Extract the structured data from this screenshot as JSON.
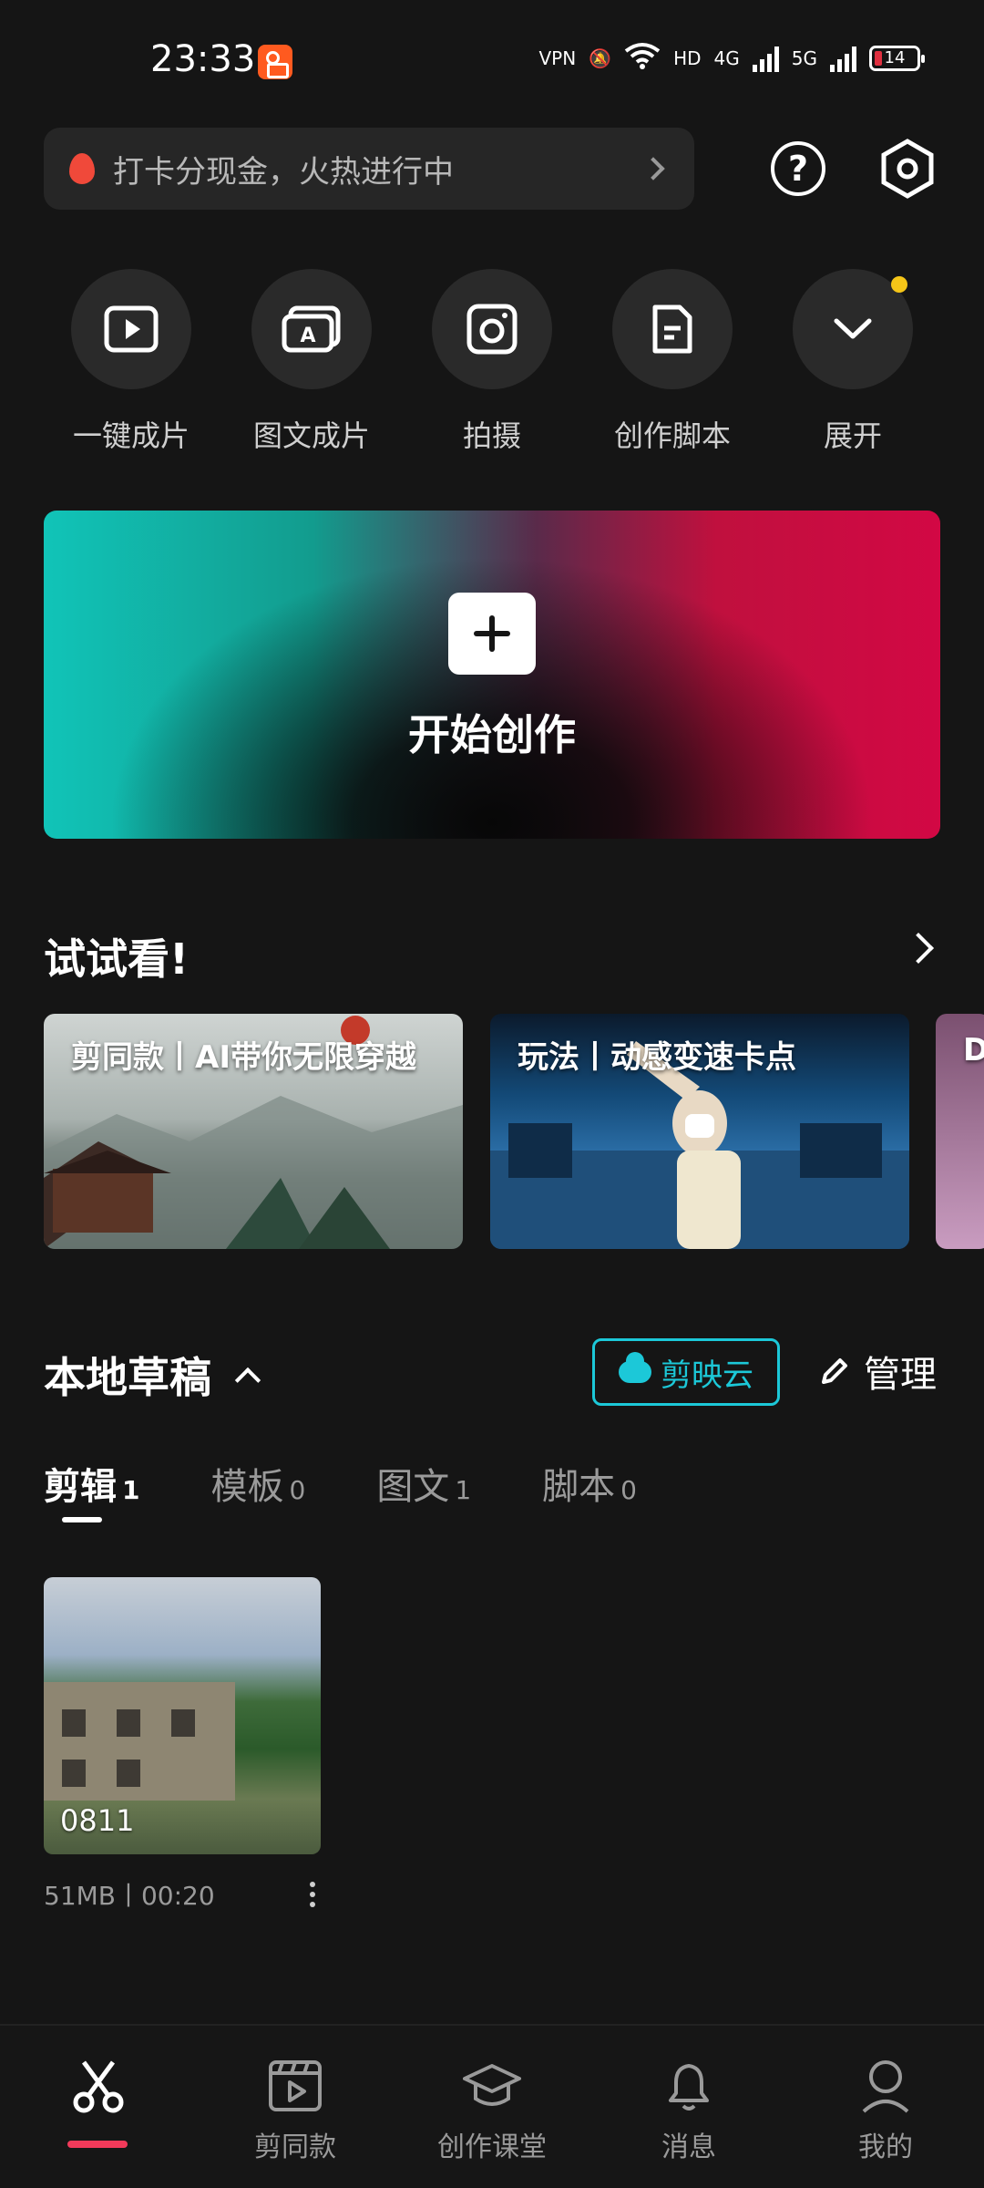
{
  "status_bar": {
    "time": "23:33",
    "vpn": "VPN",
    "hd": "HD",
    "net1": "4G",
    "net2": "5G",
    "battery": "14"
  },
  "promo": {
    "text": "打卡分现金，火热进行中"
  },
  "quick_actions": [
    {
      "label": "一键成片",
      "icon": "play-icon"
    },
    {
      "label": "图文成片",
      "icon": "image-text-icon"
    },
    {
      "label": "拍摄",
      "icon": "camera-icon"
    },
    {
      "label": "创作脚本",
      "icon": "script-icon"
    },
    {
      "label": "展开",
      "icon": "chevron-down-icon"
    }
  ],
  "create": {
    "label": "开始创作"
  },
  "try_section": {
    "title": "试试看!",
    "cards": [
      {
        "title": "剪同款丨AI带你无限穿越"
      },
      {
        "title": "玩法丨动感变速卡点"
      },
      {
        "title": "D"
      }
    ]
  },
  "drafts": {
    "title": "本地草稿",
    "cloud_label": "剪映云",
    "manage_label": "管理",
    "tabs": [
      {
        "label": "剪辑",
        "count": "1"
      },
      {
        "label": "模板",
        "count": "0"
      },
      {
        "label": "图文",
        "count": "1"
      },
      {
        "label": "脚本",
        "count": "0"
      }
    ],
    "items": [
      {
        "name": "0811",
        "meta": "51MB丨00:20"
      }
    ]
  },
  "bottom_nav": [
    {
      "label": "",
      "icon": "scissors-icon"
    },
    {
      "label": "剪同款",
      "icon": "template-icon"
    },
    {
      "label": "创作课堂",
      "icon": "graduation-cap-icon"
    },
    {
      "label": "消息",
      "icon": "bell-icon"
    },
    {
      "label": "我的",
      "icon": "user-icon"
    }
  ],
  "colors": {
    "background": "#151515",
    "accent_cyan": "#1cc8d8",
    "accent_red": "#f23a5a",
    "notify_dot": "#f5c518"
  }
}
